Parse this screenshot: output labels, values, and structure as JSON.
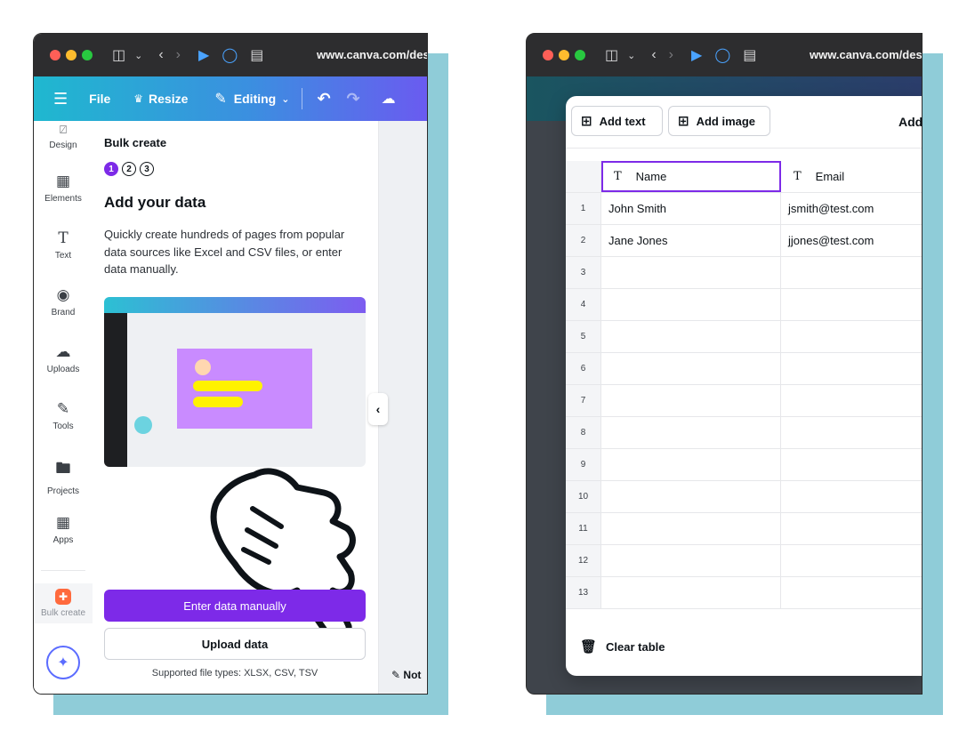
{
  "browser": {
    "url": "www.canva.com/design"
  },
  "toolbar": {
    "file_label": "File",
    "resize_label": "Resize",
    "editing_label": "Editing"
  },
  "rail": {
    "items": [
      {
        "label": "Design",
        "icon": "design-icon"
      },
      {
        "label": "Elements",
        "icon": "elements-icon"
      },
      {
        "label": "Text",
        "icon": "text-icon"
      },
      {
        "label": "Brand",
        "icon": "brand-icon"
      },
      {
        "label": "Uploads",
        "icon": "uploads-icon"
      },
      {
        "label": "Tools",
        "icon": "tools-icon"
      },
      {
        "label": "Projects",
        "icon": "projects-icon"
      },
      {
        "label": "Apps",
        "icon": "apps-icon"
      },
      {
        "label": "Bulk create",
        "icon": "bulk-create-icon"
      }
    ]
  },
  "bulk_panel": {
    "title": "Bulk create",
    "steps": [
      "1",
      "2",
      "3"
    ],
    "heading": "Add your data",
    "description": "Quickly create hundreds of pages from popular data sources like Excel and CSV files, or enter data manually.",
    "primary_button": "Enter data manually",
    "secondary_button": "Upload data",
    "supported_types": "Supported file types: XLSX, CSV, TSV"
  },
  "notes_label": "Not",
  "data_table": {
    "add_text_label": "Add text",
    "add_image_label": "Add image",
    "header_right_label": "Add",
    "columns": [
      "Name",
      "Email"
    ],
    "rows": [
      {
        "num": "1",
        "name": "John Smith",
        "email": "jsmith@test.com"
      },
      {
        "num": "2",
        "name": "Jane Jones",
        "email": "jjones@test.com"
      },
      {
        "num": "3",
        "name": "",
        "email": ""
      },
      {
        "num": "4",
        "name": "",
        "email": ""
      },
      {
        "num": "5",
        "name": "",
        "email": ""
      },
      {
        "num": "6",
        "name": "",
        "email": ""
      },
      {
        "num": "7",
        "name": "",
        "email": ""
      },
      {
        "num": "8",
        "name": "",
        "email": ""
      },
      {
        "num": "9",
        "name": "",
        "email": ""
      },
      {
        "num": "10",
        "name": "",
        "email": ""
      },
      {
        "num": "11",
        "name": "",
        "email": ""
      },
      {
        "num": "12",
        "name": "",
        "email": ""
      },
      {
        "num": "13",
        "name": "",
        "email": ""
      }
    ],
    "clear_label": "Clear table"
  },
  "colors": {
    "accent_purple": "#7d2ae8",
    "teal_backdrop": "#8fccd8"
  }
}
